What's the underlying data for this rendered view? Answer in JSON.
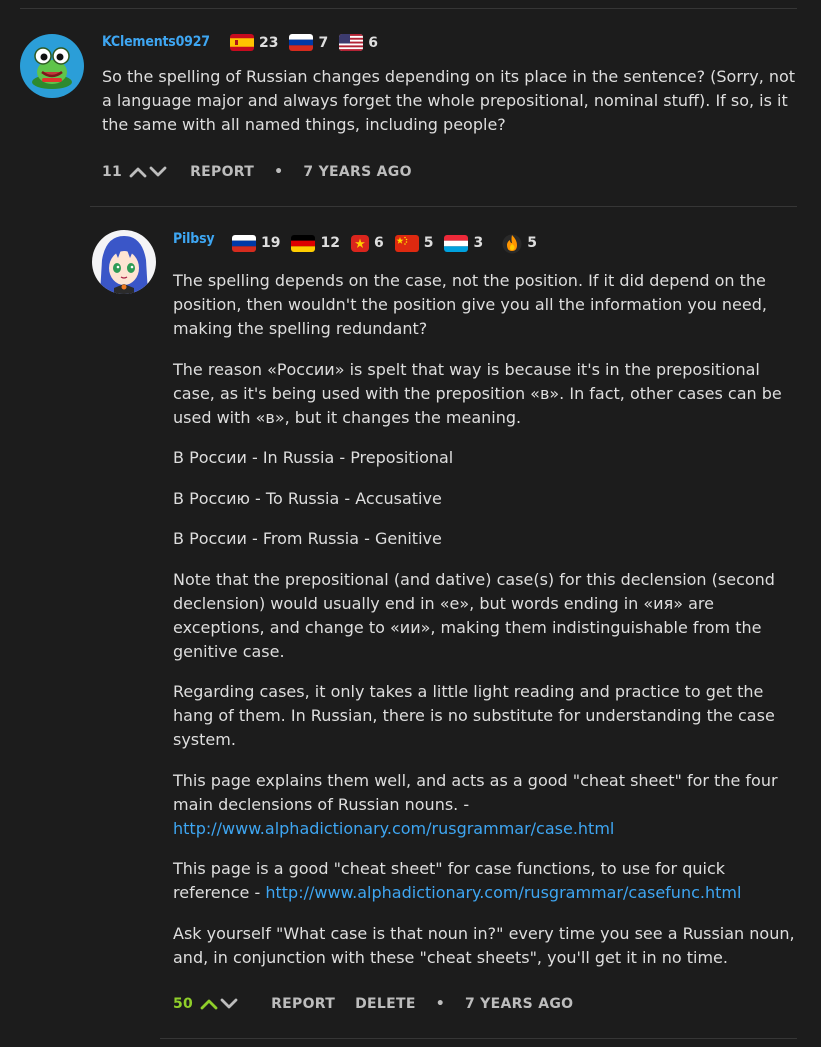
{
  "comments": [
    {
      "username": "KClements0927",
      "badges": [
        {
          "flag": "spain-flag-icon",
          "count": "23"
        },
        {
          "flag": "russia-flag-icon",
          "count": "7"
        },
        {
          "flag": "usa-flag-icon",
          "count": "6"
        }
      ],
      "paragraphs": [
        "So the spelling of Russian changes depending on its place in the sentence? (Sorry, not a language major and always forget the whole prepositional, nominal stuff). If so, is it the same with all named things, including people?"
      ],
      "score": "11",
      "report": "REPORT",
      "separator": "•",
      "time": "7 YEARS AGO"
    },
    {
      "username": "Pilbsy",
      "badges": [
        {
          "flag": "russia-flag-icon",
          "count": "19"
        },
        {
          "flag": "germany-flag-icon",
          "count": "12"
        },
        {
          "flag": "vietnam-flag-icon",
          "count": "6"
        },
        {
          "flag": "china-flag-icon",
          "count": "5"
        },
        {
          "flag": "luxembourg-flag-icon",
          "count": "3"
        },
        {
          "flag": "fire-icon",
          "count": "5"
        }
      ],
      "paragraphs": {
        "p1": "The spelling depends on the case, not the position. If it did depend on the position, then wouldn't the position give you all the information you need, making the spelling redundant?",
        "p2": "The reason «России» is spelt that way is because it's in the prepositional case, as it's being used with the preposition «в». In fact, other cases can be used with «в», but it changes the meaning.",
        "p3": "В России - In Russia - Prepositional",
        "p4": "В Россию - To Russia - Accusative",
        "p5": "В России - From Russia - Genitive",
        "p6": "Note that the prepositional (and dative) case(s) for this declension (second declension) would usually end in «е», but words ending in «ия» are exceptions, and change to «ии», making them indistinguishable from the genitive case.",
        "p7": "Regarding cases, it only takes a little light reading and practice to get the hang of them. In Russian, there is no substitute for understanding the case system.",
        "p8_text": "This page explains them well, and acts as a good \"cheat sheet\" for the four main declensions of Russian nouns. - ",
        "p8_link": "http://www.alphadictionary.com/rusgrammar/case.html",
        "p9_text": "This page is a good \"cheat sheet\" for case functions, to use for quick reference - ",
        "p9_link": "http://www.alphadictionary.com/rusgrammar/casefunc.html",
        "p10": "Ask yourself \"What case is that noun in?\" every time you see a Russian noun, and, in conjunction with these \"cheat sheets\", you'll get it in no time."
      },
      "score": "50",
      "report": "REPORT",
      "delete": "DELETE",
      "separator": "•",
      "time": "7 YEARS AGO"
    }
  ],
  "colors": {
    "background": "#1c1c1c",
    "username": "#3ea6f2",
    "link": "#3ea6f2",
    "score_upvoted": "#8fcf2a"
  }
}
